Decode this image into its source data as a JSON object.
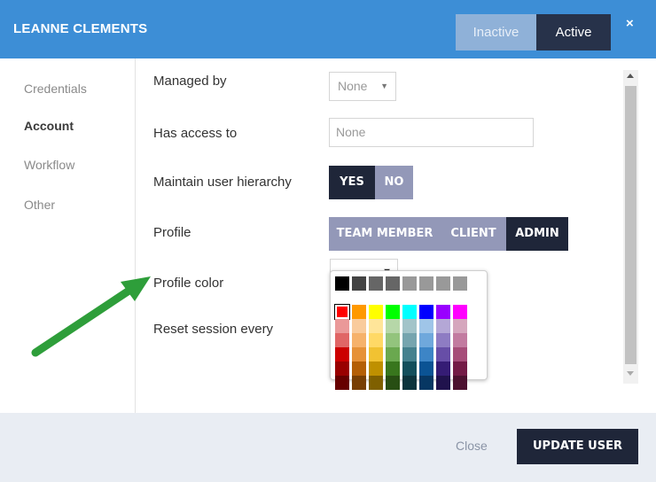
{
  "header": {
    "title": "LEANNE CLEMENTS",
    "status_options": [
      "Inactive",
      "Active"
    ],
    "close_symbol": "×"
  },
  "sidebar": {
    "items": [
      {
        "label": "Credentials"
      },
      {
        "label": "Account",
        "active": true
      },
      {
        "label": "Workflow"
      },
      {
        "label": "Other"
      }
    ]
  },
  "form": {
    "managed_by": {
      "label": "Managed by",
      "value": "None"
    },
    "has_access": {
      "label": "Has access to",
      "placeholder": "None"
    },
    "hierarchy": {
      "label": "Maintain user hierarchy",
      "options": [
        "YES",
        "NO"
      ]
    },
    "profile": {
      "label": "Profile",
      "options": [
        "TEAM MEMBER",
        "CLIENT",
        "ADMIN"
      ]
    },
    "profile_color": {
      "label": "Profile color"
    },
    "reset_session": {
      "label": "Reset session every"
    }
  },
  "palette": {
    "rows": [
      [
        "#000000",
        "#434343",
        "#666666",
        "#666666",
        "#999999",
        "#999999",
        "#999999",
        "#999999"
      ],
      [
        "#ff0000",
        "#ff9900",
        "#ffff00",
        "#00ff00",
        "#00ffff",
        "#0000ff",
        "#9900ff",
        "#ff00ff"
      ],
      [
        "#ea9999",
        "#f9cb9c",
        "#ffe599",
        "#b6d7a8",
        "#a2c4c9",
        "#9fc5e8",
        "#b4a7d6",
        "#d5a6bd"
      ],
      [
        "#e06666",
        "#f6b26b",
        "#ffd966",
        "#93c47d",
        "#76a5af",
        "#6fa8dc",
        "#8e7cc3",
        "#c27ba0"
      ],
      [
        "#cc0000",
        "#e69138",
        "#f1c232",
        "#6aa84f",
        "#45818e",
        "#3d85c6",
        "#674ea7",
        "#a64d79"
      ],
      [
        "#990000",
        "#b45f06",
        "#bf9000",
        "#38761d",
        "#134f5c",
        "#0b5394",
        "#351c75",
        "#741b47"
      ],
      [
        "#660000",
        "#783f04",
        "#7f6000",
        "#274e13",
        "#0c343d",
        "#073763",
        "#20124d",
        "#4c1130"
      ]
    ],
    "selected": "#ff0000"
  },
  "footer": {
    "close_label": "Close",
    "update_label": "UPDATE USER"
  },
  "colors": {
    "header": "#3d8ed6",
    "dark": "#1f2639",
    "muted_button": "#9398b8",
    "annotation_arrow": "#2e9e3a"
  }
}
